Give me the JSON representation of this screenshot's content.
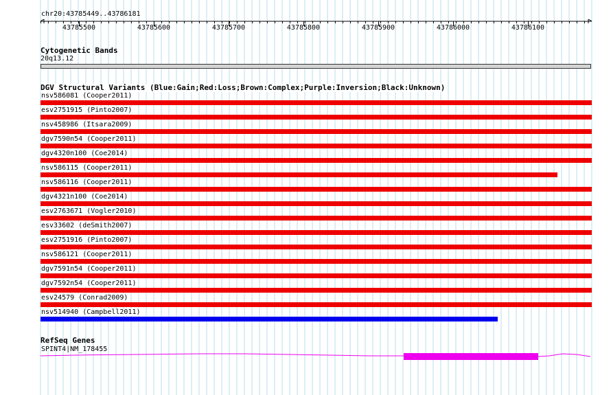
{
  "region": "chr20:43785449..43786181",
  "ruler": {
    "ticks": [
      "43785500",
      "43785600",
      "43785700",
      "43785800",
      "43785900",
      "43786000",
      "43786100"
    ]
  },
  "cytobands": {
    "title": "Cytogenetic Bands",
    "band_name": "20q13.12"
  },
  "dgv": {
    "title": "DGV Structural Variants (Blue:Gain;Red:Loss;Brown:Complex;Purple:Inversion;Black:Unknown)",
    "colors": {
      "gain": "#0000ee",
      "loss": "#ee0000"
    },
    "variants": [
      {
        "label": "nsv586081 (Cooper2011)",
        "type": "loss",
        "end_fraction": 1.0
      },
      {
        "label": "esv2751915 (Pinto2007)",
        "type": "loss",
        "end_fraction": 1.0
      },
      {
        "label": "nsv458986 (Itsara2009)",
        "type": "loss",
        "end_fraction": 1.0
      },
      {
        "label": "dgv7590n54 (Cooper2011)",
        "type": "loss",
        "end_fraction": 1.0
      },
      {
        "label": "dgv4320n100 (Coe2014)",
        "type": "loss",
        "end_fraction": 1.0
      },
      {
        "label": "nsv586115 (Cooper2011)",
        "type": "loss",
        "end_fraction": 0.938
      },
      {
        "label": "nsv586116 (Cooper2011)",
        "type": "loss",
        "end_fraction": 1.0
      },
      {
        "label": "dgv4321n100 (Coe2014)",
        "type": "loss",
        "end_fraction": 1.0
      },
      {
        "label": "esv2763671 (Vogler2010)",
        "type": "loss",
        "end_fraction": 1.0
      },
      {
        "label": "esv33602 (deSmith2007)",
        "type": "loss",
        "end_fraction": 1.0
      },
      {
        "label": "esv2751916 (Pinto2007)",
        "type": "loss",
        "end_fraction": 1.0
      },
      {
        "label": "nsv586121 (Cooper2011)",
        "type": "loss",
        "end_fraction": 1.0
      },
      {
        "label": "dgv7591n54 (Cooper2011)",
        "type": "loss",
        "end_fraction": 1.0
      },
      {
        "label": "dgv7592n54 (Cooper2011)",
        "type": "loss",
        "end_fraction": 1.0
      },
      {
        "label": "esv24579 (Conrad2009)",
        "type": "loss",
        "end_fraction": 1.0
      },
      {
        "label": "nsv514940 (Campbell2011)",
        "type": "gain",
        "end_fraction": 0.83
      }
    ]
  },
  "refseq": {
    "title": "RefSeq Genes",
    "gene_label": "SPINT4|NM_178455",
    "color": "#ee00ee"
  }
}
